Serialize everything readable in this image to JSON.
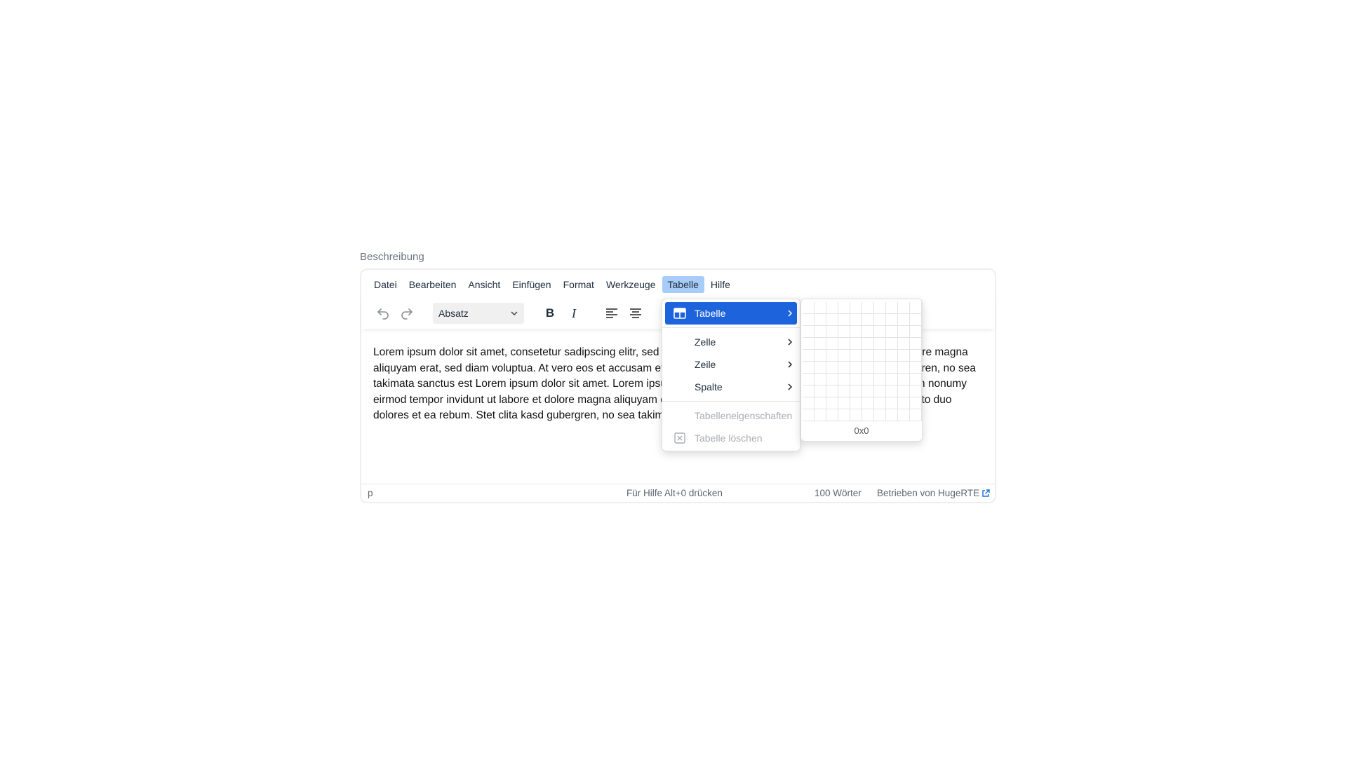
{
  "field": {
    "label": "Beschreibung"
  },
  "menubar": {
    "items": [
      "Datei",
      "Bearbeiten",
      "Ansicht",
      "Einfügen",
      "Format",
      "Werkzeuge",
      "Tabelle",
      "Hilfe"
    ],
    "active": "Tabelle"
  },
  "toolbar": {
    "undo_icon": "undo-icon",
    "redo_icon": "redo-icon",
    "blocks_value": "Absatz",
    "bold_label": "B",
    "italic_label": "I",
    "align_left_icon": "align-left-icon",
    "align_center_icon": "align-center-icon"
  },
  "content": {
    "paragraph": "Lorem ipsum dolor sit amet, consetetur sadipscing elitr, sed diam nonumy eirmod tempor invidunt ut labore et dolore magna aliquyam erat, sed diam voluptua. At vero eos et accusam et justo duo dolores et ea rebum. Stet clita kasd gubergren, no sea takimata sanctus est Lorem ipsum dolor sit amet. Lorem ipsum dolor sit amet, consetetur sadipscing elitr, sed diam nonumy eirmod tempor invidunt ut labore et dolore magna aliquyam erat, sed diam voluptua. At vero eos et accusam et justo duo dolores et ea rebum. Stet clita kasd gubergren, no sea takimata sanctus est Lorem ipsum dolor sit amet."
  },
  "statusbar": {
    "path": "p",
    "help": "Für Hilfe Alt+0 drücken",
    "words": "100 Wörter",
    "brand": "Betrieben von HugeRTE"
  },
  "dropdown": {
    "tabelle": "Tabelle",
    "zelle": "Zelle",
    "zeile": "Zeile",
    "spalte": "Spalte",
    "eigenschaften": "Tabelleneigenschaften",
    "loeschen": "Tabelle löschen"
  },
  "grid": {
    "label": "0x0",
    "rows": 10,
    "cols": 10
  },
  "colors": {
    "accent": "#1d63dc",
    "menu_active": "#a6ccf7",
    "link": "#1d6fd6"
  }
}
